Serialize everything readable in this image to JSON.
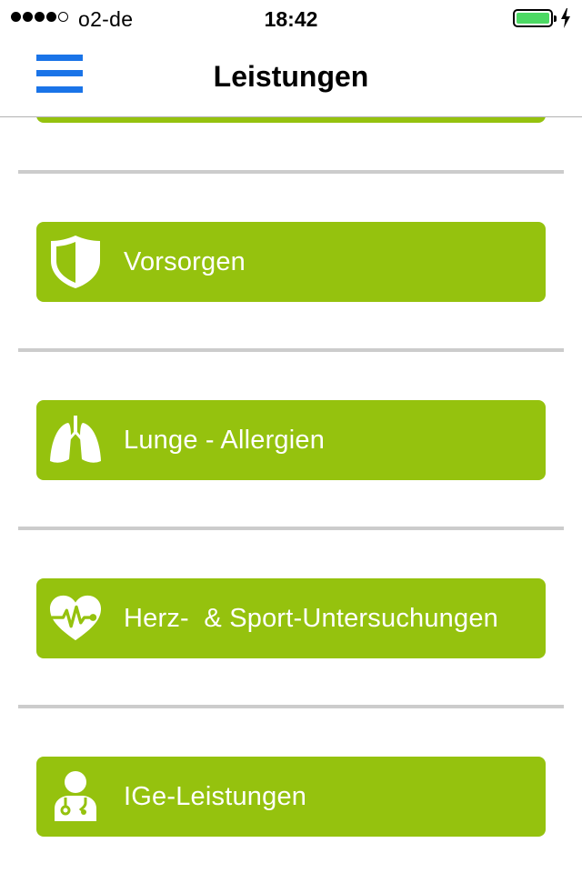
{
  "status_bar": {
    "carrier": "o2-de",
    "time": "18:42",
    "signal_bars_filled": 4,
    "signal_bars_total": 5,
    "battery_level": 1.0,
    "charging": true
  },
  "navbar": {
    "title": "Leistungen",
    "menu_icon": "hamburger-menu-icon"
  },
  "list": [
    {
      "label": "Vorsorgen",
      "icon": "shield-icon"
    },
    {
      "label": "Lunge - Allergien",
      "icon": "lungs-icon"
    },
    {
      "label": "Herz-  & Sport-Untersuchungen",
      "icon": "heart-pulse-icon"
    },
    {
      "label": "IGe-Leistungen",
      "icon": "doctor-icon"
    }
  ],
  "colors": {
    "button_green": "#95c20e",
    "menu_blue": "#1a74e8",
    "separator": "#cccccc",
    "battery_green": "#4cd964"
  }
}
